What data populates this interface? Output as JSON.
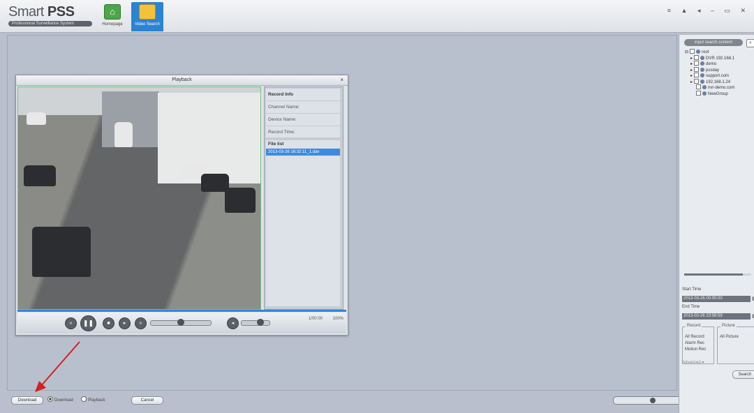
{
  "app": {
    "logo_main": "Smart",
    "logo_bold": "PSS",
    "logo_sub": "Professional Surveillance System",
    "window_controls": "≡ ▲ ◂ – ▭ ✕"
  },
  "nav": {
    "tabs": [
      {
        "label": "Homepage"
      },
      {
        "label": "Video Search"
      }
    ]
  },
  "playback": {
    "title": "Playback",
    "close": "×",
    "record_info": {
      "heading": "Record Info",
      "channel_name": "Channel Name:",
      "device_name": "Device Name:",
      "record_time": "Record Time:"
    },
    "file_list": {
      "heading": "File list",
      "files": [
        "2013-03-26 16:32:11_1.dav"
      ]
    },
    "time": "1/00:00",
    "zoom": "100%"
  },
  "bottom": {
    "download_label": "Download",
    "radio_1": "Download",
    "radio_2": "Playback",
    "cancel_label": "Cancel"
  },
  "sidebar": {
    "search_placeholder": "input search content",
    "tree": [
      {
        "label": "root",
        "level": 0
      },
      {
        "label": "DVR 192.168.1",
        "level": 1
      },
      {
        "label": "demo",
        "level": 1
      },
      {
        "label": "pssday",
        "level": 1
      },
      {
        "label": "support.com",
        "level": 1
      },
      {
        "label": "192.168.1.24",
        "level": 1
      },
      {
        "label": "nvr-demo.com",
        "level": 1
      },
      {
        "label": "NewGroup",
        "level": 1
      }
    ],
    "start_time_label": "Start Time",
    "start_time_value": "2013-03-26 00:00:00",
    "end_time_label": "End Time",
    "end_time_value": "2013-03-26 23:59:59",
    "record_group_title": "Record",
    "record_options": [
      "All Record",
      "Alarm Rec",
      "Motion Rec"
    ],
    "picture_group_title": "Picture",
    "picture_options": [
      "All Picture"
    ],
    "advanced_label": "Advanced",
    "search_button": "Search"
  }
}
